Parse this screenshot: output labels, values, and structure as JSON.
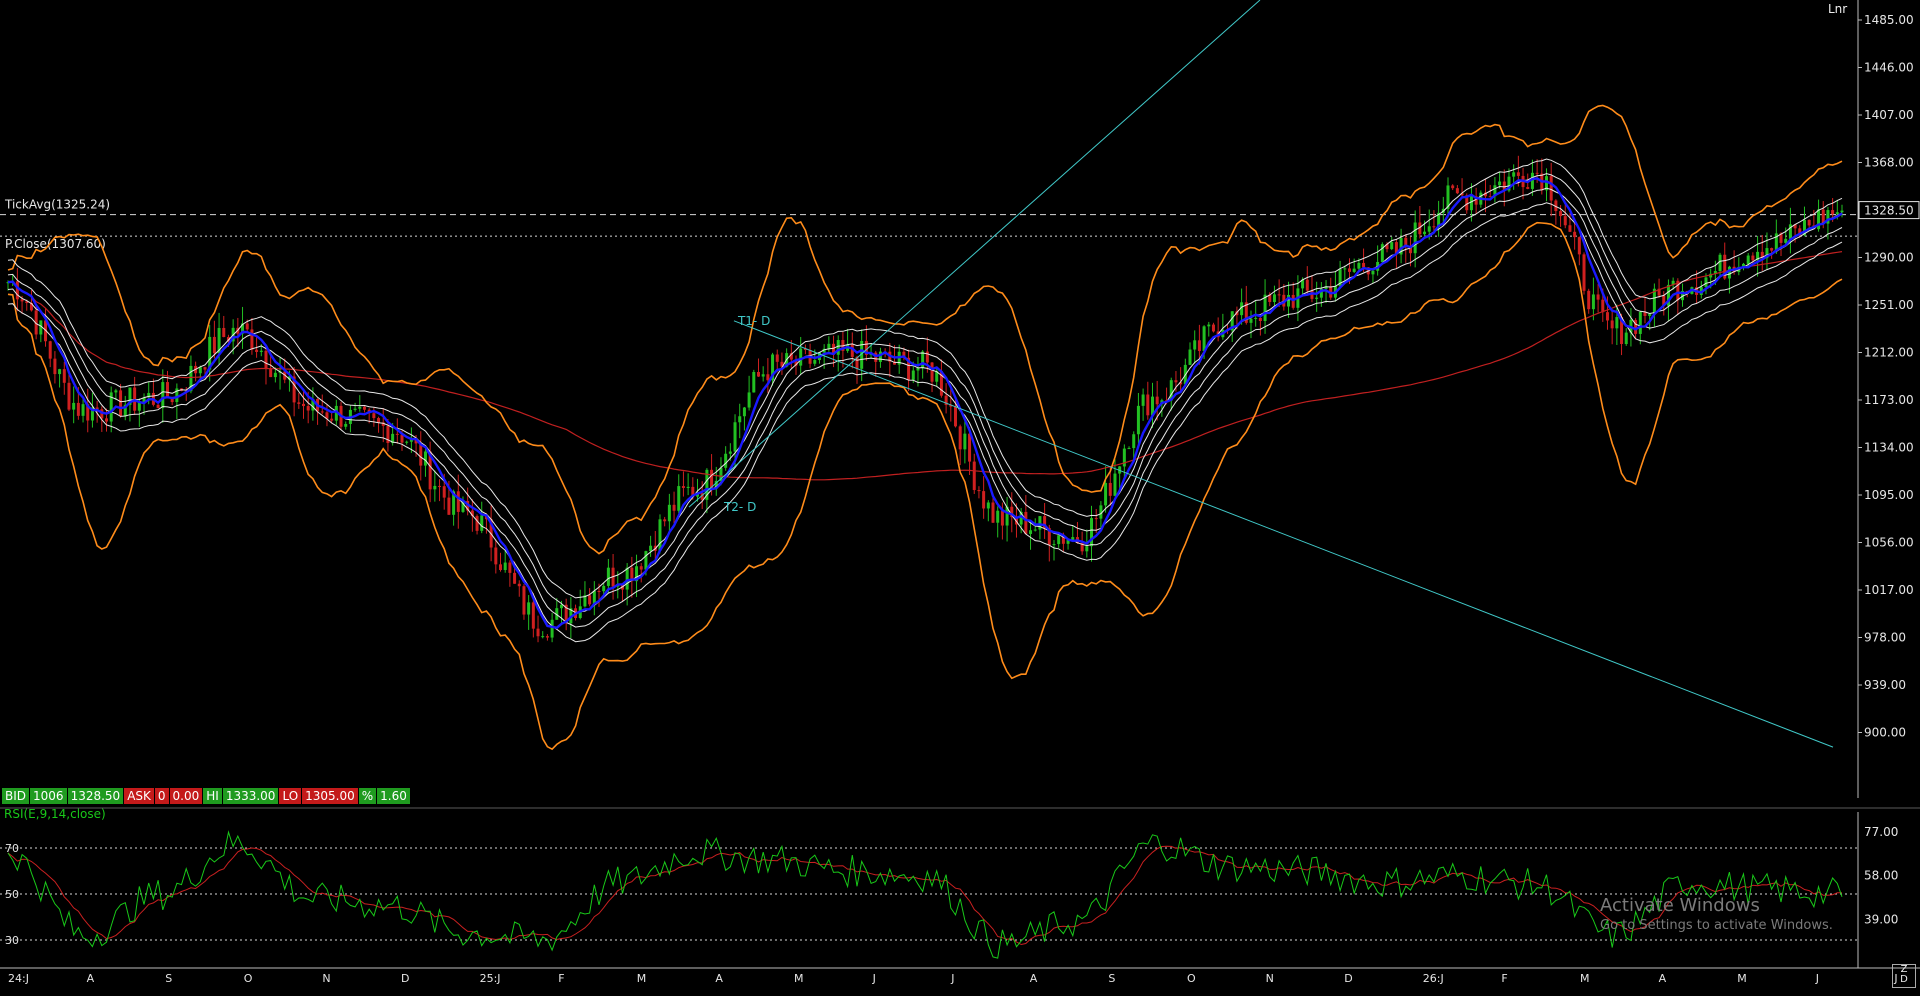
{
  "chart": {
    "scale_mode": "Lnr",
    "price_ticks": [
      "1485.00",
      "1446.00",
      "1407.00",
      "1368.00",
      "1329.00",
      "1290.00",
      "1251.00",
      "1212.00",
      "1173.00",
      "1134.00",
      "1095.00",
      "1056.00",
      "1017.00",
      "978.00",
      "939.00",
      "900.00"
    ],
    "last_price_label": "1328.50",
    "tickavg_label": "TickAvg(1325.24)",
    "pclose_label": "P.Close(1307.60)",
    "trend_labels": {
      "t1": "T1- D",
      "t2": "T2- D"
    },
    "month_labels": [
      "24:J",
      "A",
      "S",
      "O",
      "N",
      "D",
      "25:J",
      "F",
      "M",
      "A",
      "M",
      "J",
      "J",
      "A",
      "S",
      "O",
      "N",
      "D",
      "26:J",
      "F",
      "M",
      "A",
      "M",
      "J",
      "J"
    ],
    "rsi_label": "RSI(E,9,14,close)",
    "rsi_left_ticks": [
      "70",
      "50",
      "30"
    ],
    "rsi_right_ticks": [
      "77.00",
      "58.00",
      "39.00"
    ],
    "corner_box_label": "Z\nD"
  },
  "quote_bar": {
    "bid_label": "BID",
    "bid_qty": "1006",
    "bid_price": "1328.50",
    "ask_label": "ASK",
    "ask_qty": "0",
    "ask_price": "0.00",
    "hi_label": "HI",
    "hi_value": "1333.00",
    "lo_label": "LO",
    "lo_value": "1305.00",
    "pct_label": "%",
    "pct_value": "1.60"
  },
  "watermark": {
    "line1": "Activate Windows",
    "line2": "Go to Settings to activate Windows."
  },
  "colors": {
    "background": "#000000",
    "bull_candle": "#22c022",
    "bear_candle": "#d02020",
    "ema_blue": "#1a1aff",
    "envelope_white": "#e8e8e8",
    "bollinger_orange": "#ff8c1a",
    "long_ma_red": "#c02020",
    "trendline_cyan": "#40c8c8",
    "rsi_green": "#19c819",
    "rsi_signal_red": "#c82020"
  },
  "chart_data": [
    {
      "type": "candlestick",
      "title": "",
      "price_scale": "linear",
      "ylim": [
        880,
        1500
      ],
      "last_price": 1328.5,
      "tick_average": 1325.24,
      "previous_close": 1307.6,
      "x_labels": [
        "24:J",
        "A",
        "S",
        "O",
        "N",
        "D",
        "25:J",
        "F",
        "M",
        "A",
        "M",
        "J",
        "J",
        "A",
        "S",
        "O",
        "N",
        "D",
        "26:J",
        "F",
        "M",
        "A",
        "M",
        "J",
        "J"
      ],
      "approx_close_by_month": [
        {
          "x": "24:J",
          "close": 1270
        },
        {
          "x": "A",
          "close": 1165
        },
        {
          "x": "S",
          "close": 1175
        },
        {
          "x": "O",
          "close": 1230
        },
        {
          "x": "N",
          "close": 1165
        },
        {
          "x": "D",
          "close": 1150
        },
        {
          "x": "25:J",
          "close": 1080
        },
        {
          "x": "F",
          "close": 990
        },
        {
          "x": "M",
          "close": 1030
        },
        {
          "x": "A",
          "close": 1100
        },
        {
          "x": "M",
          "close": 1200
        },
        {
          "x": "J",
          "close": 1210
        },
        {
          "x": "J",
          "close": 1200
        },
        {
          "x": "A",
          "close": 1075
        },
        {
          "x": "S",
          "close": 1060
        },
        {
          "x": "O",
          "close": 1175
        },
        {
          "x": "N",
          "close": 1240
        },
        {
          "x": "D",
          "close": 1260
        },
        {
          "x": "26:J",
          "close": 1290
        },
        {
          "x": "F",
          "close": 1340
        },
        {
          "x": "M",
          "close": 1360
        },
        {
          "x": "A",
          "close": 1230
        },
        {
          "x": "M",
          "close": 1270
        },
        {
          "x": "J",
          "close": 1300
        },
        {
          "x": "J",
          "close": 1328.5
        }
      ],
      "indicators": [
        "EMA (blue)",
        "envelope bands (white)",
        "Bollinger bands (orange)",
        "long moving average (red)",
        "trend lines T1- D and T2- D (cyan)"
      ]
    },
    {
      "type": "line",
      "title": "RSI(E,9,14,close)",
      "ylim": [
        20,
        85
      ],
      "reference_levels": [
        70,
        50,
        30
      ],
      "right_ticks": [
        77,
        58,
        39
      ],
      "approx_rsi_by_month": [
        {
          "x": "24:J",
          "rsi": 68
        },
        {
          "x": "A",
          "rsi": 32
        },
        {
          "x": "S",
          "rsi": 50
        },
        {
          "x": "O",
          "rsi": 72
        },
        {
          "x": "N",
          "rsi": 48
        },
        {
          "x": "D",
          "rsi": 45
        },
        {
          "x": "25:J",
          "rsi": 33
        },
        {
          "x": "F",
          "rsi": 30
        },
        {
          "x": "M",
          "rsi": 55
        },
        {
          "x": "A",
          "rsi": 68
        },
        {
          "x": "M",
          "rsi": 65
        },
        {
          "x": "J",
          "rsi": 60
        },
        {
          "x": "J",
          "rsi": 58
        },
        {
          "x": "A",
          "rsi": 28
        },
        {
          "x": "S",
          "rsi": 38
        },
        {
          "x": "O",
          "rsi": 72
        },
        {
          "x": "N",
          "rsi": 62
        },
        {
          "x": "D",
          "rsi": 60
        },
        {
          "x": "26:J",
          "rsi": 55
        },
        {
          "x": "F",
          "rsi": 58
        },
        {
          "x": "M",
          "rsi": 54
        },
        {
          "x": "A",
          "rsi": 32
        },
        {
          "x": "M",
          "rsi": 55
        },
        {
          "x": "J",
          "rsi": 52
        },
        {
          "x": "J",
          "rsi": 50
        }
      ]
    }
  ]
}
